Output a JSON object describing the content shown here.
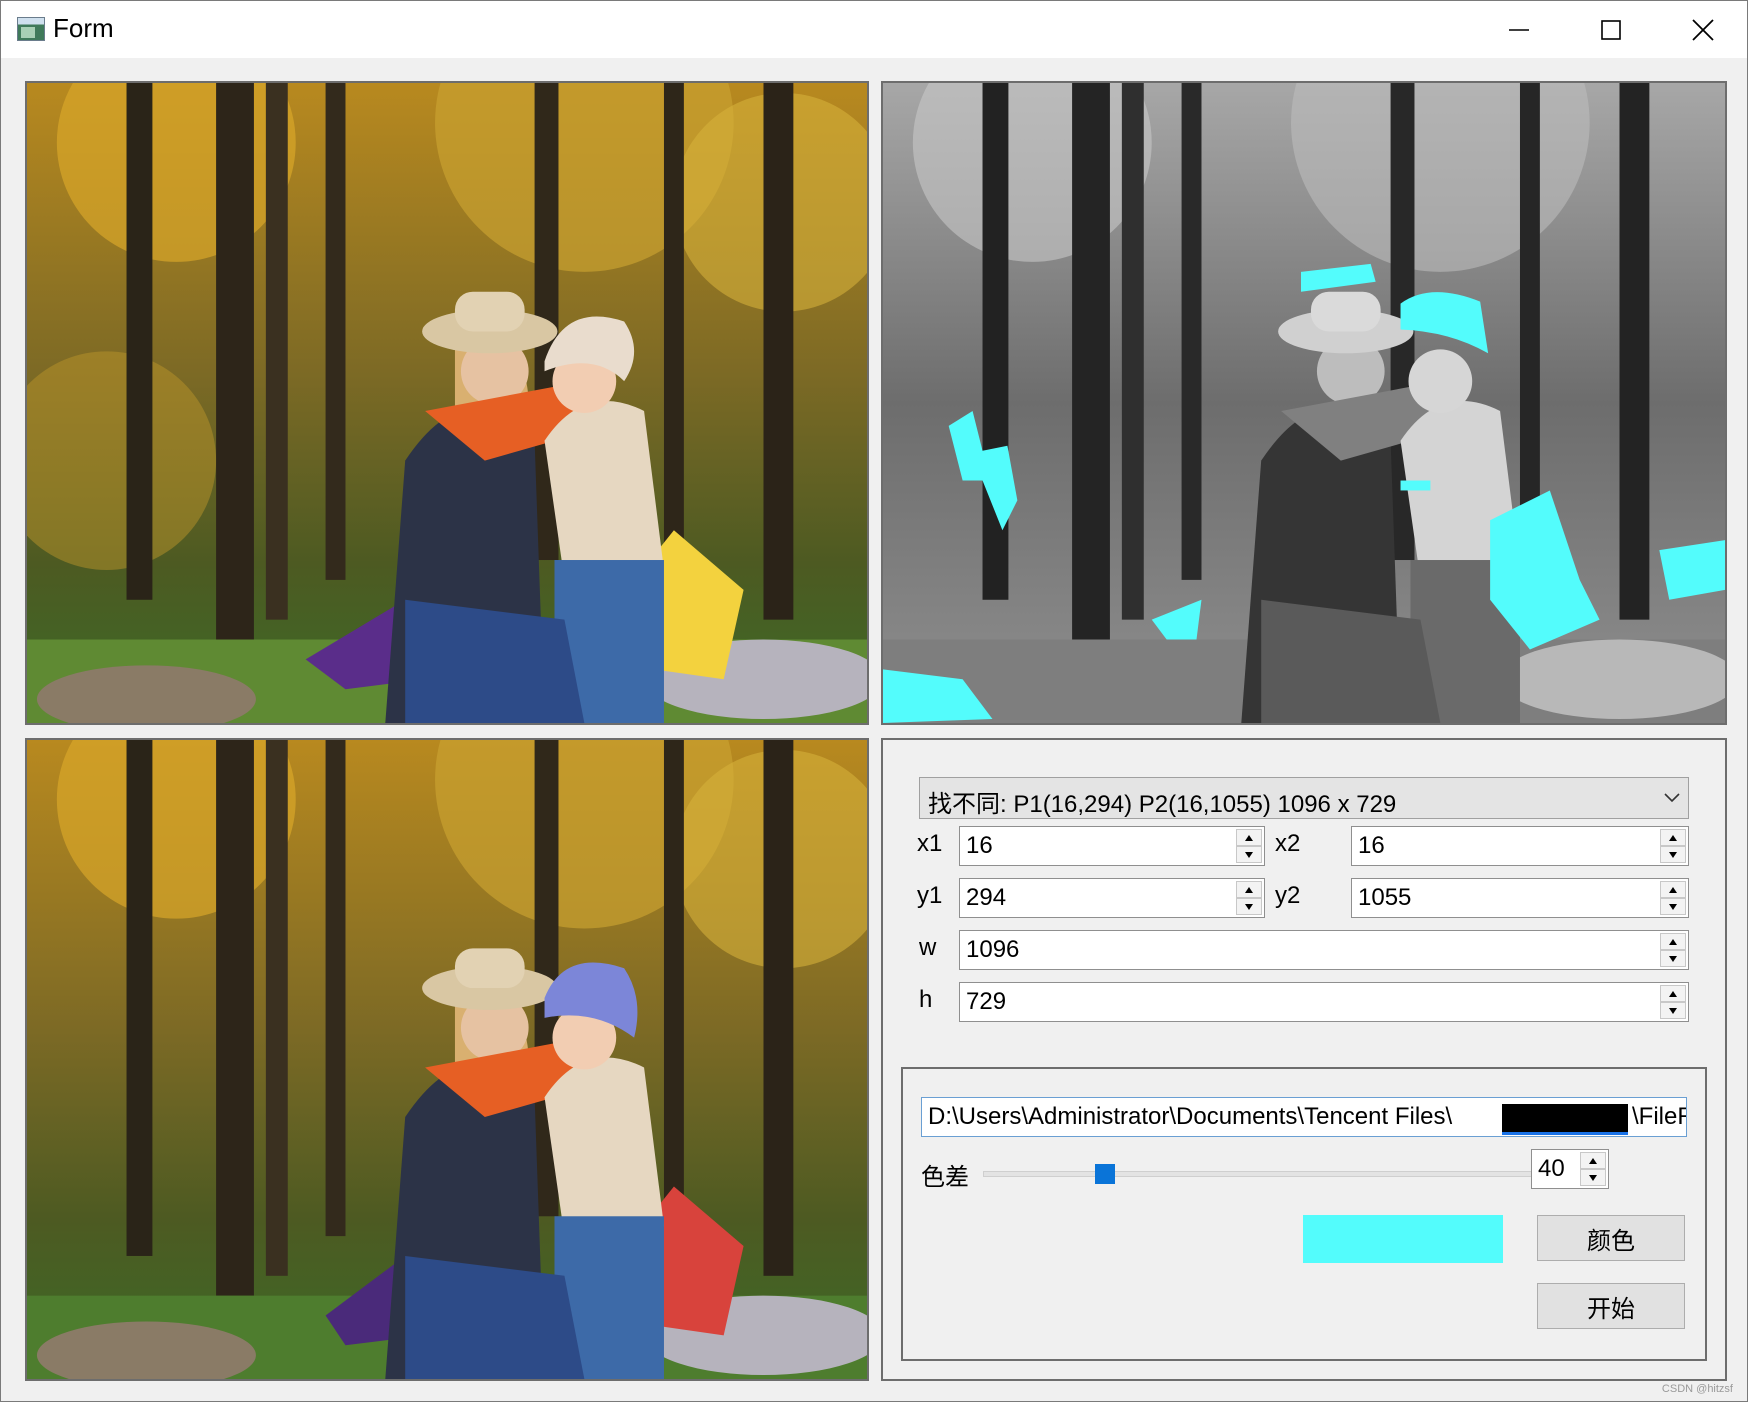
{
  "window": {
    "title": "Form",
    "icons": [
      "app-icon",
      "minimize-icon",
      "maximize-icon",
      "close-icon"
    ]
  },
  "images": {
    "original": "original-photo",
    "difference": "difference-map",
    "modified": "modified-photo",
    "highlight_color": "#53fcfc"
  },
  "controls": {
    "combo_value": "找不同: P1(16,294) P2(16,1055) 1096 x 729",
    "x1": {
      "label": "x1",
      "value": "16"
    },
    "x2": {
      "label": "x2",
      "value": "16"
    },
    "y1": {
      "label": "y1",
      "value": "294"
    },
    "y2": {
      "label": "y2",
      "value": "1055"
    },
    "w": {
      "label": "w",
      "value": "1096"
    },
    "h": {
      "label": "h",
      "value": "729"
    },
    "path_value": "D:\\Users\\Administrator\\Documents\\Tencent Files\\",
    "path_tail": "\\FileR",
    "tolerance_label": "色差",
    "tolerance_value": "40",
    "tolerance_slider_fraction": 0.2,
    "swatch_color": "#53fcfc",
    "color_button": "颜色",
    "start_button": "开始"
  },
  "watermark": "CSDN @hitzsf"
}
